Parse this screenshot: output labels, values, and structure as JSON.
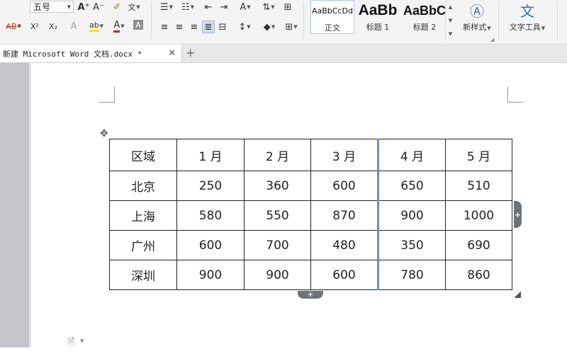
{
  "ribbon": {
    "font_size": "五号",
    "grow_font": "A⁺",
    "shrink_font": "A⁻",
    "clear_format": "A",
    "phonetic_label": "文",
    "strikethrough": "AB",
    "superscript": "X²",
    "subscript": "X₂",
    "text_effect": "A",
    "highlight": "ab",
    "font_color": "A",
    "char_shading": "A",
    "styles": [
      {
        "sample": "AaBbCcDd",
        "name": "正文"
      },
      {
        "sample": "AaBb",
        "name": "标题 1"
      },
      {
        "sample": "AaBbC",
        "name": "标题 2"
      }
    ],
    "new_style_label": "新样式",
    "text_tools_label": "文字工具"
  },
  "tab": {
    "title": "新建 Microsoft Word 文档.docx *",
    "close": "✕",
    "new": "+"
  },
  "table": {
    "rows": [
      [
        "区域",
        "1 月",
        "2 月",
        "3 月",
        "4 月",
        "5 月"
      ],
      [
        "北京",
        "250",
        "360",
        "600",
        "650",
        "510"
      ],
      [
        "上海",
        "580",
        "550",
        "870",
        "900",
        "1000"
      ],
      [
        "广州",
        "600",
        "700",
        "480",
        "350",
        "690"
      ],
      [
        "深圳",
        "900",
        "900",
        "600",
        "780",
        "860"
      ]
    ]
  },
  "controls": {
    "add_column": "+",
    "add_row": "+"
  },
  "colors": {
    "selection_border": "#6d8fbf",
    "left_panel": "#c4c6cc"
  }
}
